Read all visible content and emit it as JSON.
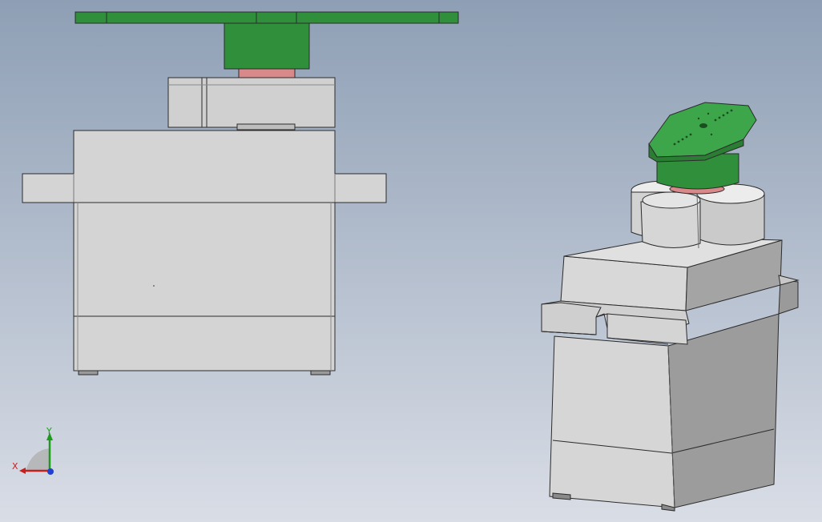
{
  "viewport": {
    "background_top": "#8e9fb5",
    "background_bottom": "#d9dde6"
  },
  "colors": {
    "part_light": "#d4d4d4",
    "part_mid": "#bfbfbf",
    "part_dark": "#9a9a9a",
    "horn_green": "#2f8f3a",
    "horn_green_light": "#3ea64a",
    "shaft_pink": "#d98989",
    "edge": "#2b2b2b"
  },
  "triad": {
    "x_label": "X",
    "y_label": "Y",
    "x_color": "#c81e1e",
    "y_color": "#1e9b1e",
    "z_color": "#2040d0"
  }
}
